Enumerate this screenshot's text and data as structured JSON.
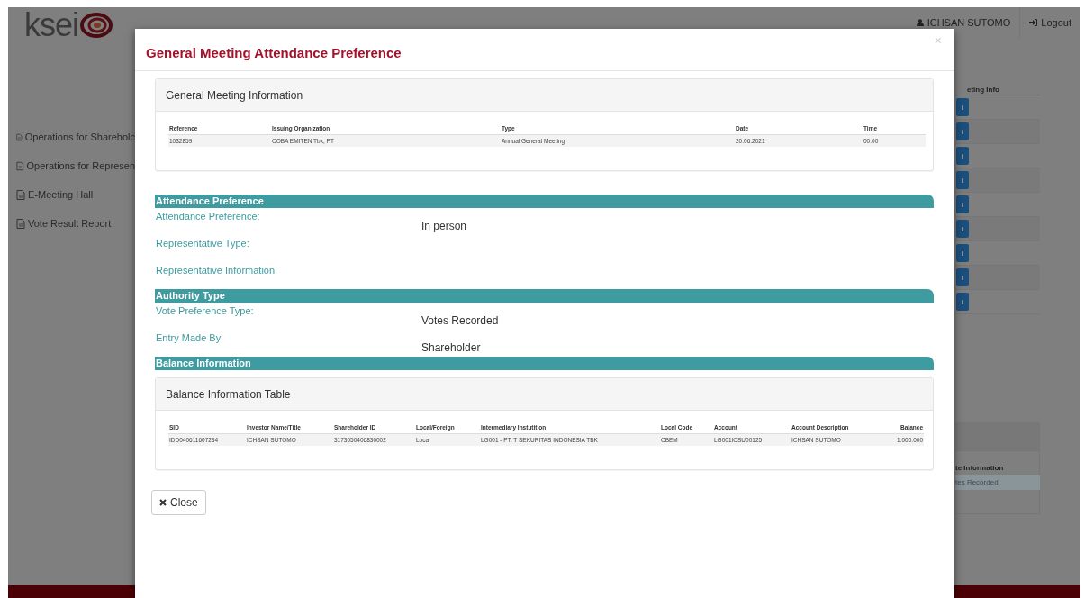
{
  "header": {
    "logo": "ksei",
    "user": "ICHSAN SUTOMO",
    "logout": "Logout"
  },
  "sidebar": {
    "items": [
      {
        "label": "Operations for Shareholc"
      },
      {
        "label": "Operations for Represen"
      },
      {
        "label": "E-Meeting Hall"
      },
      {
        "label": "Vote Result Report"
      }
    ]
  },
  "meeting_list": {
    "column": "eting Info",
    "info_buttons": [
      "i",
      "i",
      "i",
      "i",
      "i",
      "i",
      "i",
      "i",
      "i"
    ]
  },
  "vote_panel": {
    "column": "te Information",
    "value": "tes Recorded"
  },
  "modal": {
    "title": "General Meeting Attendance Preference",
    "close_icon": "×",
    "meeting_info": {
      "title": "General Meeting Information",
      "columns": [
        {
          "label": "Reference"
        },
        {
          "label": "Issuing Organization"
        },
        {
          "label": "Type"
        },
        {
          "label": "Date"
        },
        {
          "label": "Time"
        }
      ],
      "rows": [
        [
          "1032859",
          "COBA EMITEN Tbk, PT",
          "Annual General Meeting",
          "20.06.2021",
          "00:00"
        ]
      ]
    },
    "sections": [
      {
        "title": "Attendance Preference",
        "fields": [
          {
            "label": "Attendance Preference:",
            "value": "In person"
          },
          {
            "label": "Representative Type:"
          },
          {
            "label": "Representative Information:"
          }
        ]
      },
      {
        "title": "Authority Type",
        "fields": [
          {
            "label": "Vote Preference Type:",
            "value": "Votes Recorded"
          },
          {
            "label": "Entry Made By",
            "value": "Shareholder"
          }
        ]
      },
      {
        "title": "Balance Information",
        "table": {
          "title": "Balance Information Table",
          "columns": [
            {
              "label": "SID"
            },
            {
              "label": "Investor Name/Title"
            },
            {
              "label": "Shareholder ID"
            },
            {
              "label": "Local/Foreign"
            },
            {
              "label": "Intermediary Instutition"
            },
            {
              "label": "Local Code"
            },
            {
              "label": "Account"
            },
            {
              "label": "Account Description"
            },
            {
              "label": "Balance"
            }
          ],
          "rows": [
            [
              "IDD040611607234",
              "ICHSAN SUTOMO",
              "3173050406830002",
              "Local",
              "LG001 - PT. T SEKURITAS INDONESIA TBK",
              "CBEM",
              "LG001ICSU00125",
              "ICHSAN SUTOMO",
              "1.000.000"
            ]
          ]
        }
      }
    ],
    "close_button": "Close"
  }
}
